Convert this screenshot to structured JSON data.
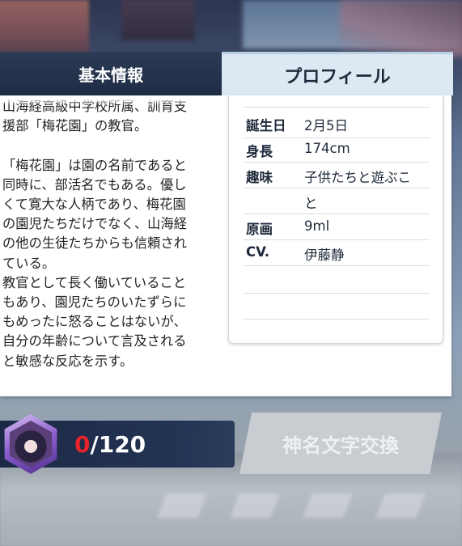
{
  "tabs": {
    "basic_info": "基本情報",
    "profile": "プロフィール"
  },
  "bio": {
    "text": "山海経高級中学校所属、訓育支\n援部「梅花園」の教官。\n\n「梅花園」は園の名前であると\n同時に、部活名でもある。優し\nくて寛大な人柄であり、梅花園\nの園児たちだけでなく、山海経\nの他の生徒たちからも信頼され\nている。\n教官として長く働いていること\nもあり、園児たちのいたずらに\nもめったに怒ることはないが、\n自分の年齢について言及される\nと敏感な反応を示す。"
  },
  "profile": {
    "rows": [
      {
        "label": "誕生日",
        "value": "2月5日"
      },
      {
        "label": "身長",
        "value": "174cm"
      },
      {
        "label": "趣味",
        "value": "子供たちと遊ぶこ"
      },
      {
        "label": "",
        "value": "と"
      },
      {
        "label": "原画",
        "value": "9ml"
      },
      {
        "label": "CV.",
        "value": "伊藤静"
      }
    ]
  },
  "counter": {
    "current": "0",
    "max": "/120"
  },
  "exchange_button": "神名文字交換",
  "colors": {
    "tab_active_bg": "#dce9f3",
    "tab_inactive_bg": "#1e2c44",
    "counter_current": "#e8242b",
    "button_disabled": "#c9ccd0"
  }
}
